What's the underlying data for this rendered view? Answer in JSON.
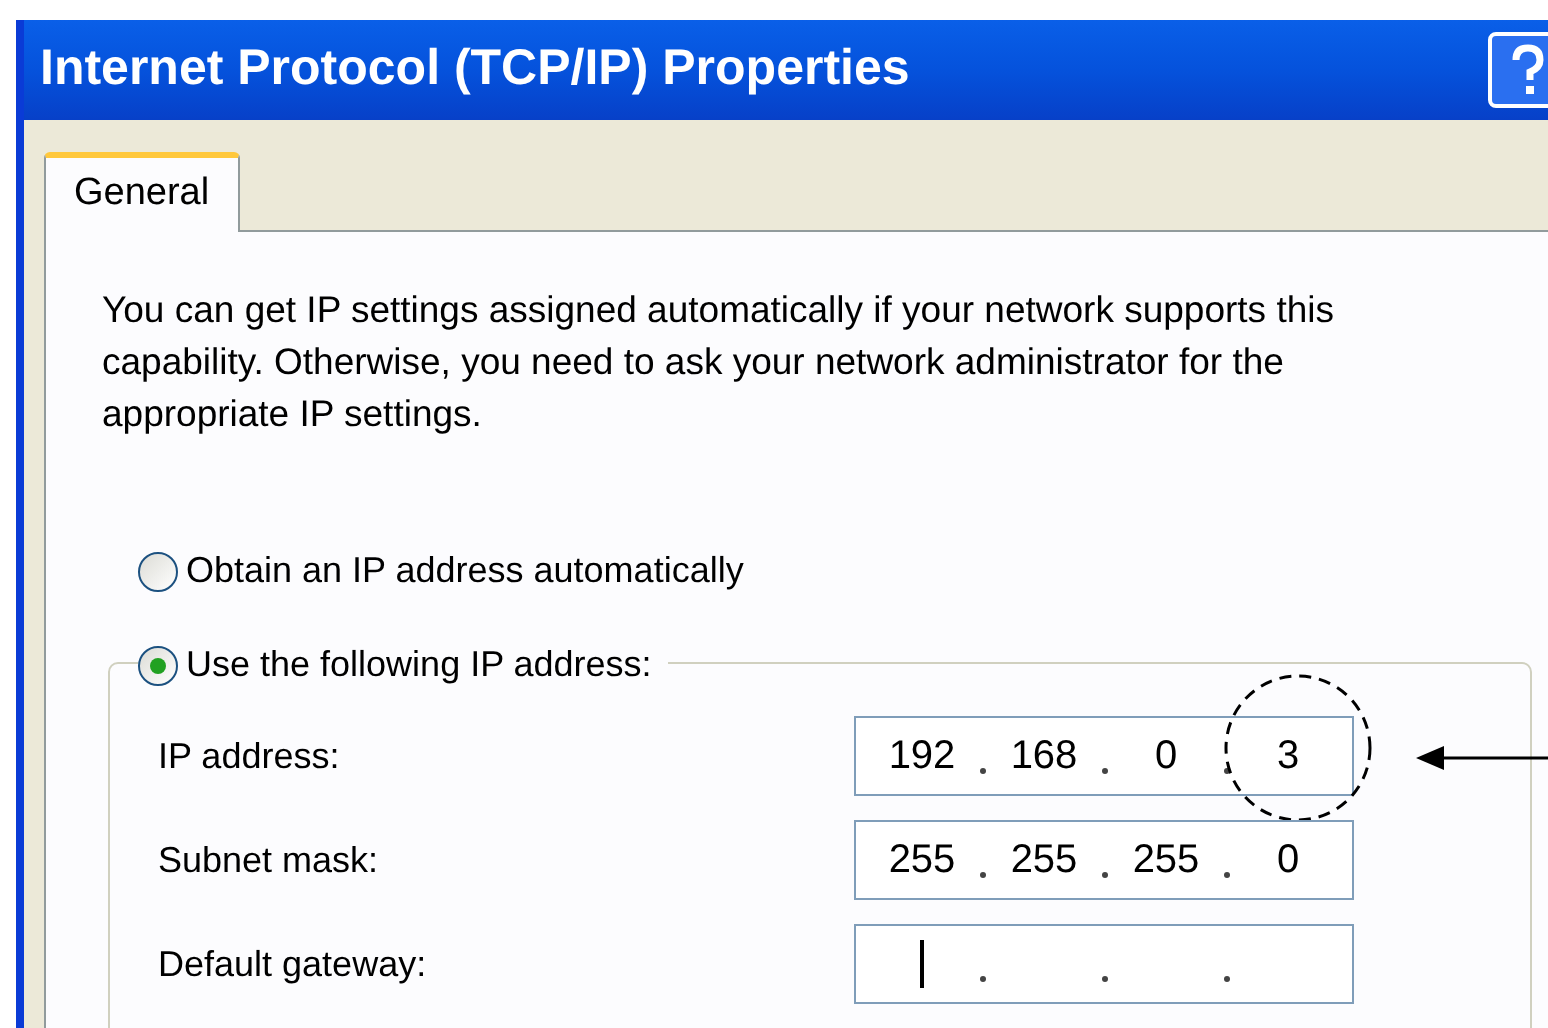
{
  "window": {
    "title": "Internet Protocol (TCP/IP) Properties"
  },
  "tabs": [
    {
      "label": "General",
      "selected": true
    }
  ],
  "description": "You can get IP settings assigned automatically if your network supports this capability. Otherwise, you need to ask your network administrator for the appropriate IP settings.",
  "options": [
    {
      "label": "Obtain an IP address automatically",
      "selected": false
    },
    {
      "label": "Use the following IP address:",
      "selected": true
    }
  ],
  "fields": [
    {
      "label": "IP address:",
      "octets": [
        "192",
        "168",
        "0",
        "3"
      ],
      "focused": false,
      "highlighted": true
    },
    {
      "label": "Subnet mask:",
      "octets": [
        "255",
        "255",
        "255",
        "0"
      ],
      "focused": false,
      "highlighted": false
    },
    {
      "label": "Default gateway:",
      "focused": true,
      "highlighted": false
    }
  ]
}
